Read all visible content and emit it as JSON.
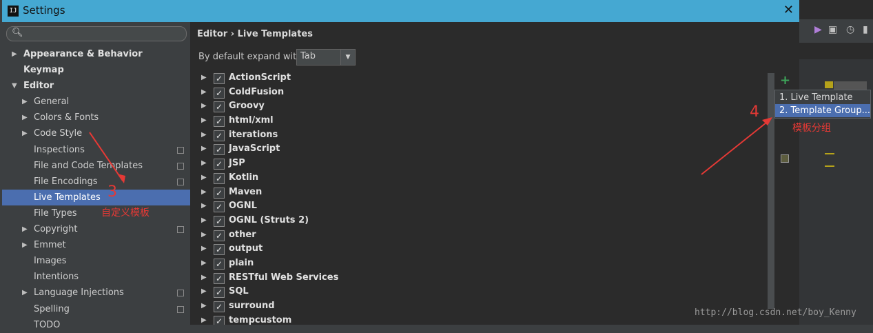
{
  "window": {
    "title": "Settings",
    "logo": "IJ"
  },
  "search": {
    "placeholder": ""
  },
  "sidebar": {
    "items": [
      {
        "label": "Appearance & Behavior",
        "level": 0,
        "arrow": "right",
        "bold": true
      },
      {
        "label": "Keymap",
        "level": 0,
        "arrow": "",
        "bold": true
      },
      {
        "label": "Editor",
        "level": 0,
        "arrow": "down",
        "bold": true
      },
      {
        "label": "General",
        "level": 1,
        "arrow": "right"
      },
      {
        "label": "Colors & Fonts",
        "level": 1,
        "arrow": "right"
      },
      {
        "label": "Code Style",
        "level": 1,
        "arrow": "right"
      },
      {
        "label": "Inspections",
        "level": 1,
        "arrow": "",
        "copy": true
      },
      {
        "label": "File and Code Templates",
        "level": 1,
        "arrow": "",
        "copy": true
      },
      {
        "label": "File Encodings",
        "level": 1,
        "arrow": "",
        "copy": true
      },
      {
        "label": "Live Templates",
        "level": 1,
        "arrow": "",
        "selected": true
      },
      {
        "label": "File Types",
        "level": 1,
        "arrow": ""
      },
      {
        "label": "Copyright",
        "level": 1,
        "arrow": "right",
        "copy": true
      },
      {
        "label": "Emmet",
        "level": 1,
        "arrow": "right"
      },
      {
        "label": "Images",
        "level": 1,
        "arrow": ""
      },
      {
        "label": "Intentions",
        "level": 1,
        "arrow": ""
      },
      {
        "label": "Language Injections",
        "level": 1,
        "arrow": "right",
        "copy": true
      },
      {
        "label": "Spelling",
        "level": 1,
        "arrow": "",
        "copy": true
      },
      {
        "label": "TODO",
        "level": 1,
        "arrow": ""
      }
    ]
  },
  "main": {
    "breadcrumb": "Editor › Live Templates",
    "expand_label": "By default expand with",
    "expand_value": "Tab",
    "groups": [
      "ActionScript",
      "ColdFusion",
      "Groovy",
      "html/xml",
      "iterations",
      "JavaScript",
      "JSP",
      "Kotlin",
      "Maven",
      "OGNL",
      "OGNL (Struts 2)",
      "other",
      "output",
      "plain",
      "RESTful Web Services",
      "SQL",
      "surround",
      "tempcustom"
    ]
  },
  "popup": {
    "items": [
      {
        "label": "1. Live Template"
      },
      {
        "label": "2. Template Group..."
      }
    ]
  },
  "annotations": {
    "num3": "3",
    "text3": "自定义模板",
    "num4": "4",
    "text4": "模板分组"
  },
  "watermark": "http://blog.csdn.net/boy_Kenny",
  "colors": {
    "accent": "#45a8d2",
    "selection": "#4b6eaf",
    "annotation": "#e53935",
    "add": "#3ea55a"
  },
  "icons": {
    "search": "search-icon",
    "close": "close-icon",
    "add": "plus-icon"
  }
}
